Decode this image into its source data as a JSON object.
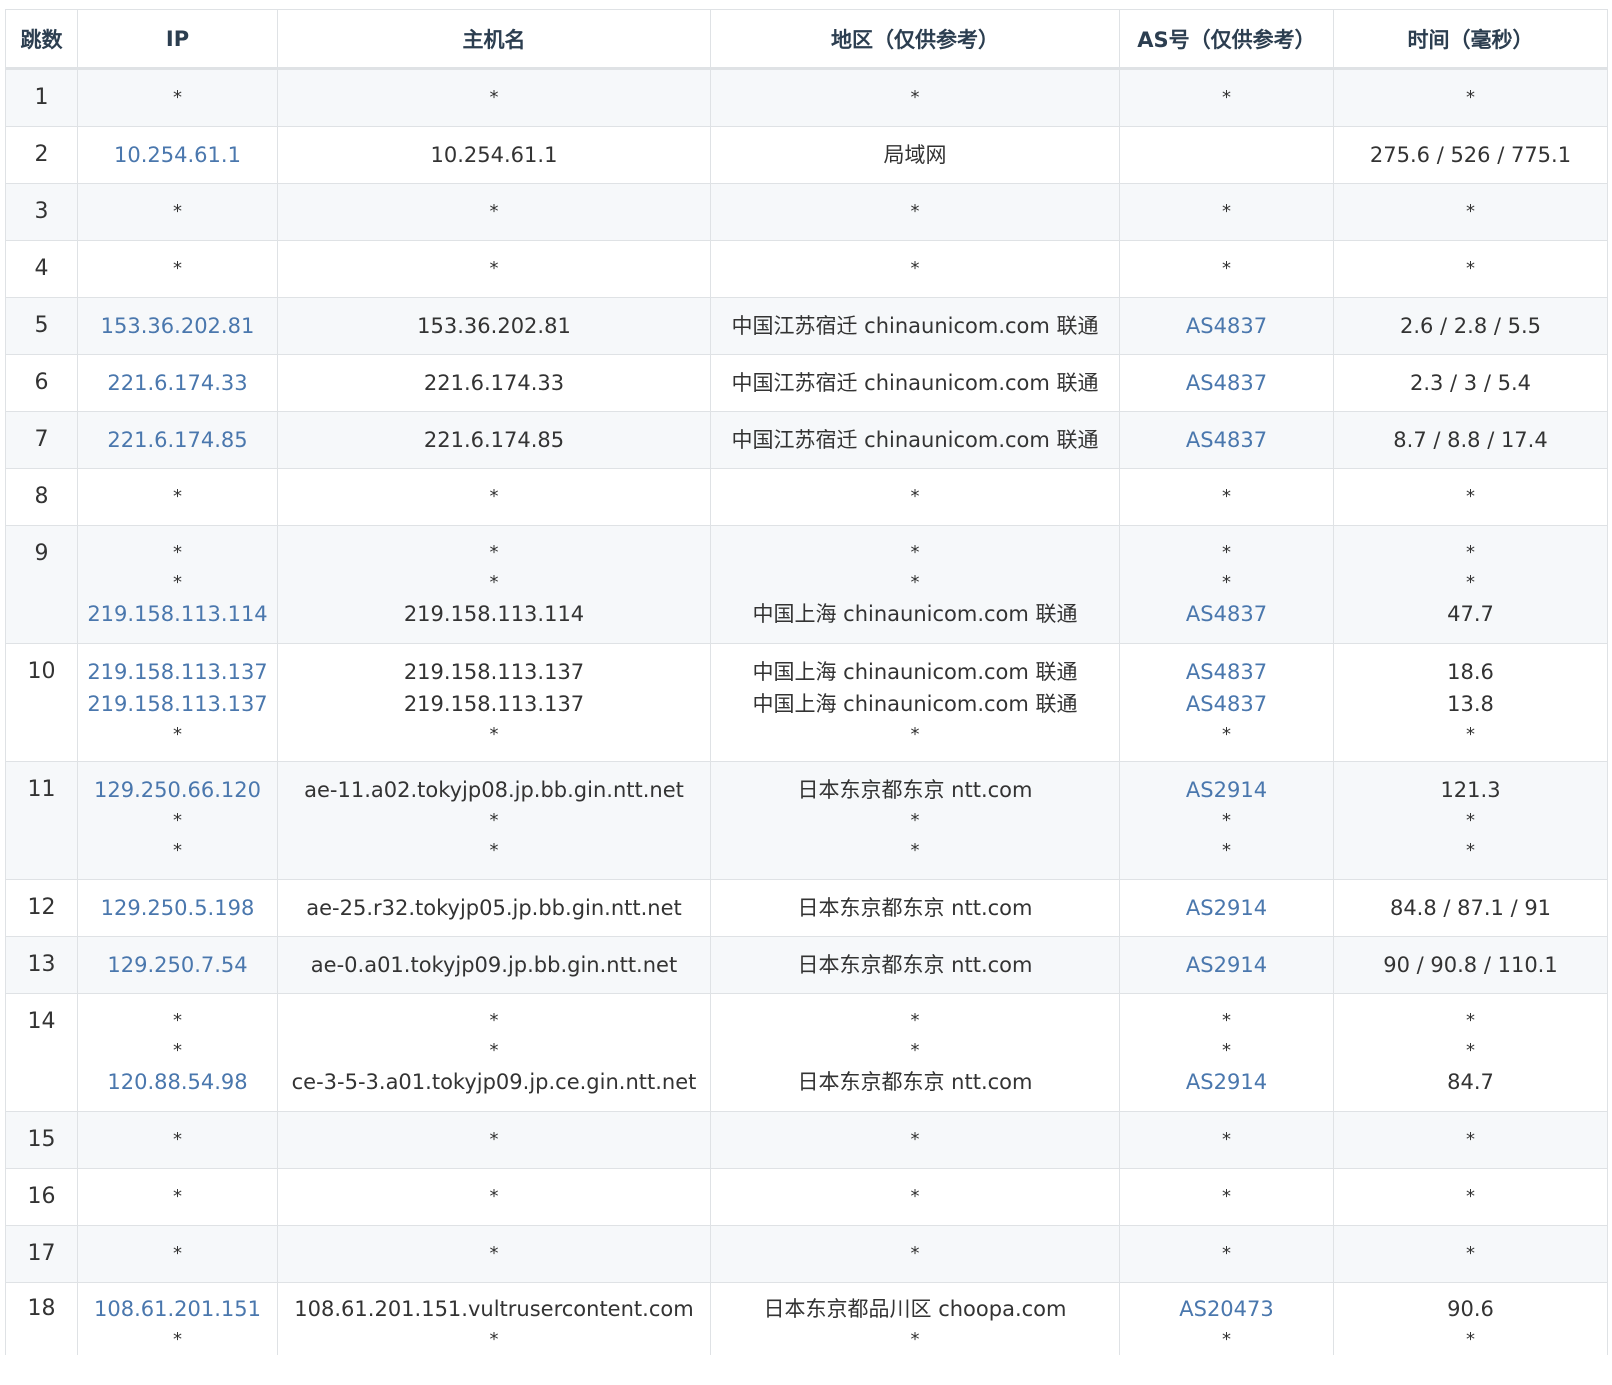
{
  "table": {
    "headers": [
      "跳数",
      "IP",
      "主机名",
      "地区（仅供参考）",
      "AS号（仅供参考）",
      "时间（毫秒）"
    ],
    "colors": {
      "link": "#4a77ad",
      "text": "#333333",
      "header": "#2c3e50",
      "stripe": "#f6f8fa",
      "border": "#dfe2e5"
    },
    "rows": [
      {
        "hop": "1",
        "ip": [
          "*"
        ],
        "host": [
          "*"
        ],
        "region": [
          "*"
        ],
        "as": [
          "*"
        ],
        "time": [
          "*"
        ]
      },
      {
        "hop": "2",
        "ip": [
          "10.254.61.1"
        ],
        "host": [
          "10.254.61.1"
        ],
        "region": [
          "局域网"
        ],
        "as": [
          ""
        ],
        "time": [
          "275.6 / 526 / 775.1"
        ]
      },
      {
        "hop": "3",
        "ip": [
          "*"
        ],
        "host": [
          "*"
        ],
        "region": [
          "*"
        ],
        "as": [
          "*"
        ],
        "time": [
          "*"
        ]
      },
      {
        "hop": "4",
        "ip": [
          "*"
        ],
        "host": [
          "*"
        ],
        "region": [
          "*"
        ],
        "as": [
          "*"
        ],
        "time": [
          "*"
        ]
      },
      {
        "hop": "5",
        "ip": [
          "153.36.202.81"
        ],
        "host": [
          "153.36.202.81"
        ],
        "region": [
          "中国江苏宿迁 chinaunicom.com 联通"
        ],
        "as": [
          "AS4837"
        ],
        "time": [
          "2.6 / 2.8 / 5.5"
        ]
      },
      {
        "hop": "6",
        "ip": [
          "221.6.174.33"
        ],
        "host": [
          "221.6.174.33"
        ],
        "region": [
          "中国江苏宿迁 chinaunicom.com 联通"
        ],
        "as": [
          "AS4837"
        ],
        "time": [
          "2.3 / 3 / 5.4"
        ]
      },
      {
        "hop": "7",
        "ip": [
          "221.6.174.85"
        ],
        "host": [
          "221.6.174.85"
        ],
        "region": [
          "中国江苏宿迁 chinaunicom.com 联通"
        ],
        "as": [
          "AS4837"
        ],
        "time": [
          "8.7 / 8.8 / 17.4"
        ]
      },
      {
        "hop": "8",
        "ip": [
          "*"
        ],
        "host": [
          "*"
        ],
        "region": [
          "*"
        ],
        "as": [
          "*"
        ],
        "time": [
          "*"
        ]
      },
      {
        "hop": "9",
        "ip": [
          "*",
          "*",
          "219.158.113.114"
        ],
        "host": [
          "*",
          "*",
          "219.158.113.114"
        ],
        "region": [
          "*",
          "*",
          "中国上海 chinaunicom.com 联通"
        ],
        "as": [
          "*",
          "*",
          "AS4837"
        ],
        "time": [
          "*",
          "*",
          "47.7"
        ]
      },
      {
        "hop": "10",
        "ip": [
          "219.158.113.137",
          "219.158.113.137",
          "*"
        ],
        "host": [
          "219.158.113.137",
          "219.158.113.137",
          "*"
        ],
        "region": [
          "中国上海 chinaunicom.com 联通",
          "中国上海 chinaunicom.com 联通",
          "*"
        ],
        "as": [
          "AS4837",
          "AS4837",
          "*"
        ],
        "time": [
          "18.6",
          "13.8",
          "*"
        ]
      },
      {
        "hop": "11",
        "ip": [
          "129.250.66.120",
          "*",
          "*"
        ],
        "host": [
          "ae-11.a02.tokyjp08.jp.bb.gin.ntt.net",
          "*",
          "*"
        ],
        "region": [
          "日本东京都东京 ntt.com",
          "*",
          "*"
        ],
        "as": [
          "AS2914",
          "*",
          "*"
        ],
        "time": [
          "121.3",
          "*",
          "*"
        ]
      },
      {
        "hop": "12",
        "ip": [
          "129.250.5.198"
        ],
        "host": [
          "ae-25.r32.tokyjp05.jp.bb.gin.ntt.net"
        ],
        "region": [
          "日本东京都东京 ntt.com"
        ],
        "as": [
          "AS2914"
        ],
        "time": [
          "84.8 / 87.1 / 91"
        ]
      },
      {
        "hop": "13",
        "ip": [
          "129.250.7.54"
        ],
        "host": [
          "ae-0.a01.tokyjp09.jp.bb.gin.ntt.net"
        ],
        "region": [
          "日本东京都东京 ntt.com"
        ],
        "as": [
          "AS2914"
        ],
        "time": [
          "90 / 90.8 / 110.1"
        ]
      },
      {
        "hop": "14",
        "ip": [
          "*",
          "*",
          "120.88.54.98"
        ],
        "host": [
          "*",
          "*",
          "ce-3-5-3.a01.tokyjp09.jp.ce.gin.ntt.net"
        ],
        "region": [
          "*",
          "*",
          "日本东京都东京 ntt.com"
        ],
        "as": [
          "*",
          "*",
          "AS2914"
        ],
        "time": [
          "*",
          "*",
          "84.7"
        ]
      },
      {
        "hop": "15",
        "ip": [
          "*"
        ],
        "host": [
          "*"
        ],
        "region": [
          "*"
        ],
        "as": [
          "*"
        ],
        "time": [
          "*"
        ]
      },
      {
        "hop": "16",
        "ip": [
          "*"
        ],
        "host": [
          "*"
        ],
        "region": [
          "*"
        ],
        "as": [
          "*"
        ],
        "time": [
          "*"
        ]
      },
      {
        "hop": "17",
        "ip": [
          "*"
        ],
        "host": [
          "*"
        ],
        "region": [
          "*"
        ],
        "as": [
          "*"
        ],
        "time": [
          "*"
        ]
      },
      {
        "hop": "18",
        "ip": [
          "108.61.201.151",
          "*"
        ],
        "host": [
          "108.61.201.151.vultrusercontent.com",
          "*"
        ],
        "region": [
          "日本东京都品川区 choopa.com",
          "*"
        ],
        "as": [
          "AS20473",
          "*"
        ],
        "time": [
          "90.6",
          "*"
        ]
      }
    ]
  }
}
